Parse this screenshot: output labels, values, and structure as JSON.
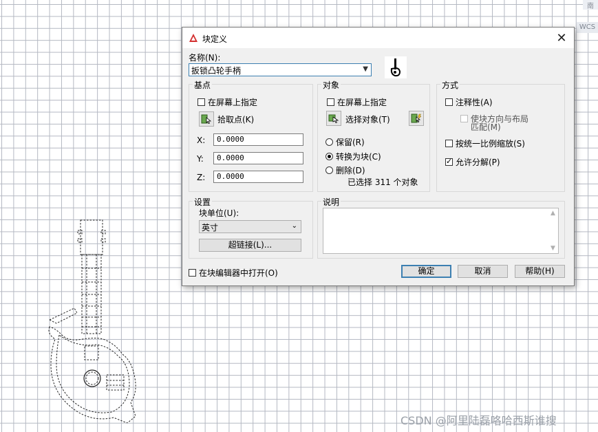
{
  "canvas": {
    "viewcube_label": "南",
    "wcs_label": "WCS",
    "watermark": "CSDN @阿里陆磊咯哈西斯谁搜"
  },
  "dialog": {
    "title": "块定义",
    "close_glyph": "✕",
    "name": {
      "label": "名称(N):",
      "value": "扳锁凸轮手柄"
    },
    "base_point": {
      "group_label": "基点",
      "specify_on_screen": {
        "label": "在屏幕上指定",
        "checked": false
      },
      "pick_point_label": "拾取点(K)",
      "x": {
        "label": "X:",
        "value": "0.0000"
      },
      "y": {
        "label": "Y:",
        "value": "0.0000"
      },
      "z": {
        "label": "Z:",
        "value": "0.0000"
      }
    },
    "objects": {
      "group_label": "对象",
      "specify_on_screen": {
        "label": "在屏幕上指定",
        "checked": false
      },
      "select_objects_label": "选择对象(T)",
      "retain": {
        "label": "保留(R)",
        "selected": false
      },
      "convert_to_block": {
        "label": "转换为块(C)",
        "selected": true
      },
      "delete": {
        "label": "删除(D)",
        "selected": false
      },
      "selected_status": "已选择 311 个对象"
    },
    "behavior": {
      "group_label": "方式",
      "annotative": {
        "label": "注释性(A)",
        "checked": false
      },
      "match_orientation": {
        "label_line1": "使块方向与布局",
        "label_line2": "匹配(M)",
        "checked": false,
        "disabled": true
      },
      "scale_uniformly": {
        "label": "按统一比例缩放(S)",
        "checked": false
      },
      "allow_exploding": {
        "label": "允许分解(P)",
        "checked": true
      }
    },
    "settings": {
      "group_label": "设置",
      "block_unit_label": "块单位(U):",
      "block_unit_value": "英寸",
      "hyperlink_button": "超链接(L)..."
    },
    "description": {
      "group_label": "说明",
      "value": ""
    },
    "open_in_editor": {
      "label": "在块编辑器中打开(O)",
      "checked": false
    },
    "buttons": {
      "ok": "确定",
      "cancel": "取消",
      "help": "帮助(H)"
    }
  }
}
